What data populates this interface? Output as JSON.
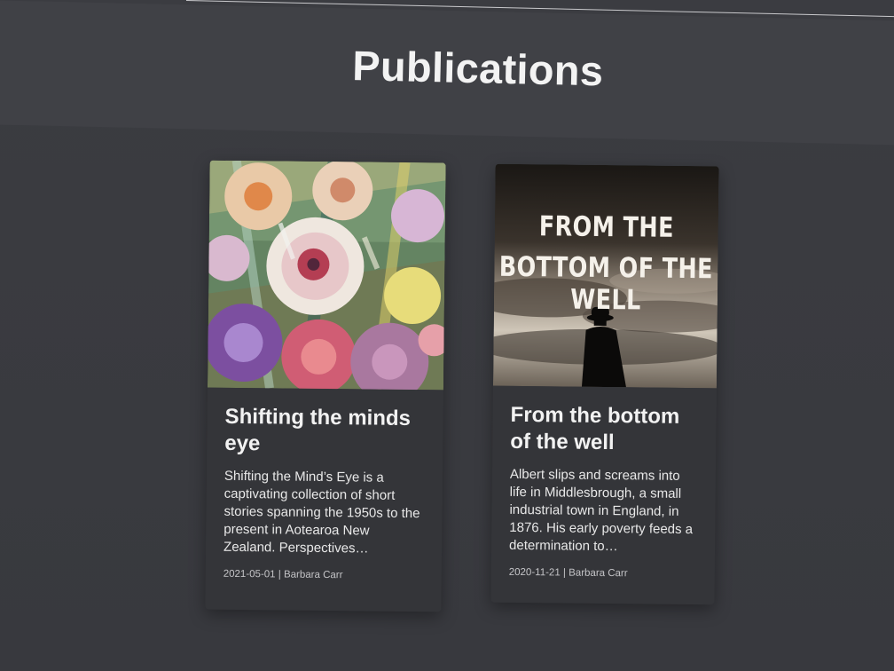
{
  "page": {
    "title": "Publications"
  },
  "publications": [
    {
      "title": "Shifting the minds eye",
      "excerpt": "Shifting the Mind’s Eye is a captivating collection of short stories spanning the 1950s to the present in Aotearoa New Zealand. Perspectives…",
      "date": "2021-05-01",
      "separator": "|",
      "author": "Barbara Carr",
      "cover_icon": "floral-painting-cover"
    },
    {
      "title": "From the bottom of the well",
      "excerpt": "Albert slips and screams into life in Middlesbrough, a small industrial town in England, in 1876. His early poverty feeds a determination to…",
      "date": "2020-11-21",
      "separator": "|",
      "author": "Barbara Carr",
      "cover_icon": "silhouette-cover",
      "cover_text_line1": "FROM THE",
      "cover_text_line2": "BOTTOM OF THE WELL"
    }
  ],
  "colors": {
    "background": "#3a3b40",
    "card": "#343539",
    "title_text": "#f3f3f3"
  }
}
